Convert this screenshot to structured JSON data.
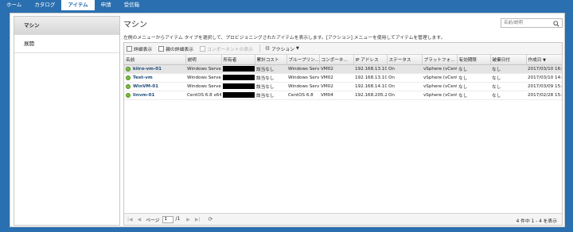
{
  "nav": {
    "tabs": [
      {
        "label": "ホーム"
      },
      {
        "label": "カタログ"
      },
      {
        "label": "アイテム"
      },
      {
        "label": "申請"
      },
      {
        "label": "受信箱"
      }
    ]
  },
  "sidebar": {
    "items": [
      {
        "label": "マシン"
      },
      {
        "label": "展開"
      }
    ]
  },
  "main": {
    "title": "マシン",
    "search_placeholder": "名前/説明",
    "description": "左側のメニューからアイテム タイプを選択して、プロビジョニングされたアイテムを表示します。[アクション] メニューを使用してアイテムを管理します。"
  },
  "toolbar": {
    "details": "詳細表示",
    "parent_details": "親の詳細表示",
    "components": "コンポーネントの表示",
    "actions": "アクション"
  },
  "table": {
    "columns": [
      "名前",
      "説明",
      "所有者",
      "累計コスト",
      "ブループリン...",
      "コンポーネ...",
      "IP アドレス",
      "ステータス",
      "プラットフォ...",
      "有効期限",
      "破棄日付",
      "作成日"
    ],
    "rows": [
      {
        "name": "kiiro-vm-01",
        "desc": "Windows Serve",
        "cost": "該当なし",
        "blueprint": "Windows Serve",
        "component": "VM02",
        "ip": "192.168.13.107",
        "status": "On",
        "platform": "vSphere (vCent",
        "expires": "なし",
        "destroy": "なし",
        "created": "2017/03/10 16:5"
      },
      {
        "name": "Test-vm",
        "desc": "Windows Serve",
        "cost": "該当なし",
        "blueprint": "Windows Serve",
        "component": "VM02",
        "ip": "192.168.13.105",
        "status": "On",
        "platform": "vSphere (vCent",
        "expires": "なし",
        "destroy": "なし",
        "created": "2017/03/10 14:0"
      },
      {
        "name": "WinVM-01",
        "desc": "Windows Serve",
        "cost": "該当なし",
        "blueprint": "Windows Serve",
        "component": "VM02",
        "ip": "192.168.14.101",
        "status": "On",
        "platform": "vSphere (vCent",
        "expires": "なし",
        "destroy": "なし",
        "created": "2017/03/09 15:3"
      },
      {
        "name": "linvm-01",
        "desc": "CentOS 6.8 x64",
        "cost": "該当なし",
        "blueprint": "CentOS 6.8",
        "component": "VM04",
        "ip": "192.168.205.21",
        "status": "On",
        "platform": "vSphere (vCent",
        "expires": "なし",
        "destroy": "なし",
        "created": "2017/02/28 15:5"
      }
    ]
  },
  "pager": {
    "page_label": "ページ",
    "page_value": "1",
    "of_label": "/1",
    "count": "4 件中 1 - 4 を表示"
  },
  "colors": {
    "header_blue": "#2a6fb0",
    "status_green": "#7cbf3a"
  }
}
